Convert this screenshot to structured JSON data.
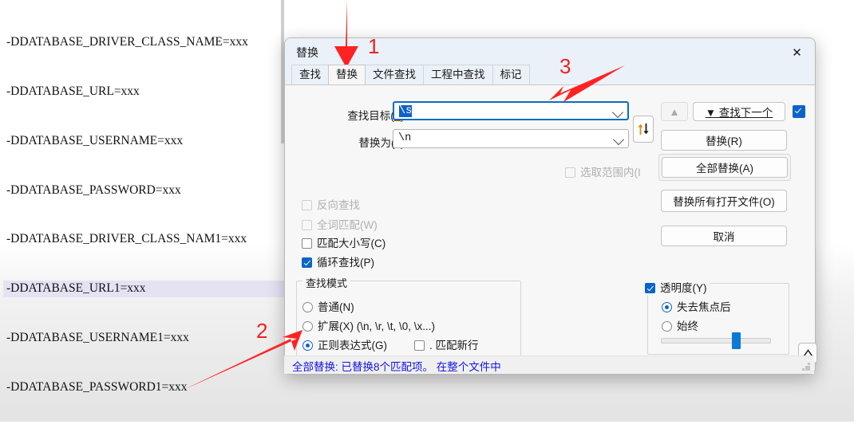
{
  "editor": {
    "lines": [
      {
        "text": "-DDATABASE_DRIVER_CLASS_NAME=xxx",
        "highlighted": false
      },
      {
        "text": "-DDATABASE_URL=xxx",
        "highlighted": false
      },
      {
        "text": "-DDATABASE_USERNAME=xxx",
        "highlighted": false
      },
      {
        "text": "-DDATABASE_PASSWORD=xxx",
        "highlighted": false
      },
      {
        "text": "-DDATABASE_DRIVER_CLASS_NAM1=xxx",
        "highlighted": false
      },
      {
        "text": "-DDATABASE_URL1=xxx",
        "highlighted": true
      },
      {
        "text": "-DDATABASE_USERNAME1=xxx",
        "highlighted": false
      },
      {
        "text": "-DDATABASE_PASSWORD1=xxx",
        "highlighted": false
      }
    ],
    "highlight_color": "#e3e3f4"
  },
  "dialog": {
    "title": "替换",
    "close_label": "✕",
    "tabs": [
      {
        "label": "查找",
        "active": false
      },
      {
        "label": "替换",
        "active": true
      },
      {
        "label": "文件查找",
        "active": false
      },
      {
        "label": "工程中查找",
        "active": false
      },
      {
        "label": "标记",
        "active": false
      }
    ],
    "fields": {
      "find_label": "查找目标(F) :",
      "find_label_plain": "查找目标",
      "find_accel": "F",
      "find_value": "\\s",
      "find_focused": true,
      "replace_label": "替换为(L) :",
      "replace_label_plain": "替换为",
      "replace_accel": "L",
      "replace_value": "\\n"
    },
    "swap_icon": "swap-vertical-icon",
    "options": [
      {
        "label": "选取范围内(I",
        "accel": "I",
        "checked": false,
        "disabled": true,
        "name": "in-selection"
      },
      {
        "label": "反向查找",
        "accel": "",
        "checked": false,
        "disabled": true,
        "name": "backward-search"
      },
      {
        "label": "全词匹配(W)",
        "accel": "W",
        "checked": false,
        "disabled": true,
        "name": "match-whole-word"
      },
      {
        "label": "匹配大小写(C)",
        "accel": "C",
        "checked": false,
        "disabled": false,
        "name": "match-case"
      },
      {
        "label": "循环查找(P)",
        "accel": "P",
        "checked": true,
        "disabled": false,
        "name": "wrap-around"
      }
    ],
    "search_mode": {
      "title": "查找模式",
      "items": [
        {
          "label": "普通(N)",
          "accel": "N",
          "selected": false,
          "name": "normal"
        },
        {
          "label": "扩展(X) (\\n, \\r, \\t, \\0, \\x...)",
          "accel": "X",
          "selected": false,
          "name": "extended"
        },
        {
          "label": "正则表达式(G)",
          "accel": "G",
          "selected": true,
          "name": "regular-expression"
        }
      ],
      "dot_matches_newline": {
        "label": ". 匹配新行",
        "checked": false
      }
    },
    "buttons": {
      "up": "▲",
      "find_next": "▼ 查找下一个",
      "find_next_checkbox_checked": true,
      "replace": "替换(R)",
      "replace_all": "全部替换(A)",
      "replace_all_open_files": "替换所有打开文件(O)",
      "cancel": "取消"
    },
    "transparency": {
      "label": "透明度(Y)",
      "accel": "Y",
      "checked": true,
      "options": [
        {
          "label": "失去焦点后",
          "selected": true,
          "name": "on-losing-focus"
        },
        {
          "label": "始终",
          "selected": false,
          "name": "always"
        }
      ],
      "slider_value": 64
    },
    "collapse_icon": "chevron-up-icon",
    "status": "全部替换: 已替换8个匹配项。 在整个文件中",
    "status_color": "#1414e0"
  },
  "annotations": {
    "color": "#ee2222",
    "markers": [
      {
        "number": "1",
        "target": "tab-replace"
      },
      {
        "number": "2",
        "target": "radio-regular-expression"
      },
      {
        "number": "3",
        "target": "find-target-input"
      }
    ]
  }
}
